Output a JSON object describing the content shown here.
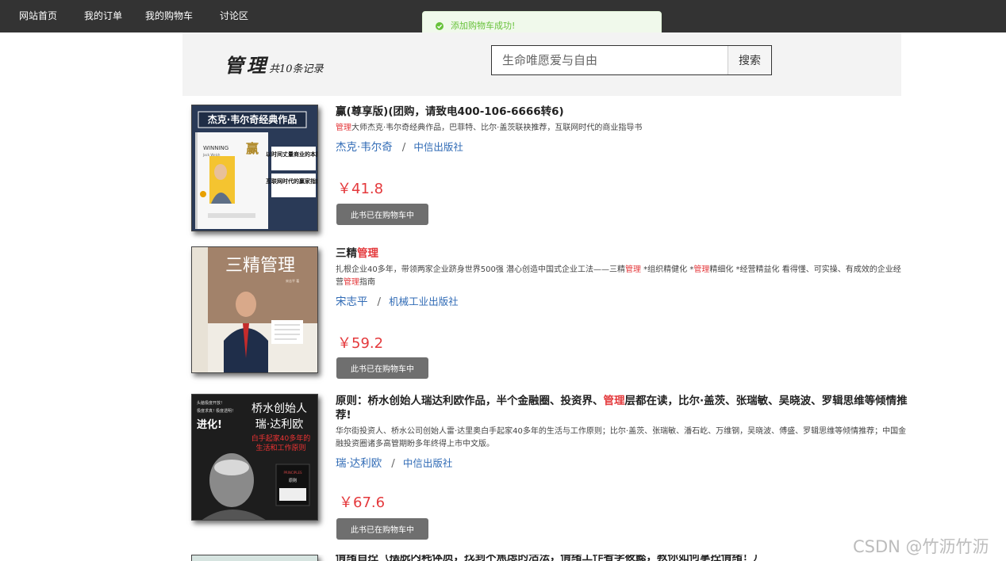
{
  "nav": {
    "home": "网站首页",
    "orders": "我的订单",
    "cart": "我的购物车",
    "forum": "讨论区"
  },
  "toast": {
    "message": "添加购物车成功!",
    "status_color": "#67c23a"
  },
  "header": {
    "title": "管理",
    "subtitle": "共10条记录",
    "search_placeholder": "生命唯愿爱与自由",
    "search_button": "搜索"
  },
  "books": [
    {
      "title": "赢(尊享版)(团购，请致电400-106-6666转6)",
      "desc_parts": [
        {
          "text": "管理",
          "hl": true
        },
        {
          "text": "大师杰克·韦尔奇经典作品，巴菲特、比尔·盖茨联袂推荐，互联网时代的商业指导书",
          "hl": false
        }
      ],
      "author": "杰克·韦尔奇",
      "publisher": "中信出版社",
      "price": "￥41.8",
      "button": "此书已在购物车中",
      "cover": {
        "banner": "杰克·韦尔奇经典作品",
        "title_en": "WINNING",
        "author_en": "Jack Welch",
        "title_cn": "赢",
        "side1": "以时间丈量商业的本质",
        "side2": "互联网时代的赢家指南"
      }
    },
    {
      "title_parts": [
        {
          "text": "三精",
          "hl": false
        },
        {
          "text": "管理",
          "hl": true
        }
      ],
      "desc_parts": [
        {
          "text": "扎根企业40多年，带领两家企业跻身世界500强 潜心创造中国式企业工法——三精",
          "hl": false
        },
        {
          "text": "管理",
          "hl": true
        },
        {
          "text": " *组织精健化 *",
          "hl": false
        },
        {
          "text": "管理",
          "hl": true
        },
        {
          "text": "精细化 *经营精益化 看得懂、可实操、有成效的企业经营",
          "hl": false
        },
        {
          "text": "管理",
          "hl": true
        },
        {
          "text": "指南",
          "hl": false
        }
      ],
      "author": "宋志平",
      "publisher": "机械工业出版社",
      "price": "￥59.2",
      "button": "此书已在购物车中",
      "cover": {
        "title_cn": "三精管理",
        "author_cn": "宋志平 著"
      }
    },
    {
      "title_parts": [
        {
          "text": "原则：桥水创始人瑞达利欧作品，半个金融圈、投资界、",
          "hl": false
        },
        {
          "text": "管理",
          "hl": true
        },
        {
          "text": "层都在读，比尔·盖茨、张瑞敏、吴晓波、罗辑思维等倾情推荐!",
          "hl": false
        }
      ],
      "desc": "华尔街投资人、桥水公司创始人雷·达里奥白手起家40多年的生活与工作原则；比尔·盖茨、张瑞敏、潘石屹、万维钢，吴晓波、傅盛、罗辑思维等倾情推荐；中国金融投资圈诸多高管期盼多年终得上市中文版。",
      "author": "瑞·达利欧",
      "publisher": "中信出版社",
      "price": "￥67.6",
      "button": "此书已在购物车中",
      "cover": {
        "top": "头脑极度开放！",
        "mid1": "极度求真！",
        "mid2": "极度透明！",
        "evolve": "进化!",
        "big1": "桥水创始人",
        "big2": "瑞·达利欧",
        "red1": "白手起家40多年的",
        "red2": "生活和工作原则",
        "book_en": "PRINCIPLES",
        "book_cn": "原则"
      }
    },
    {
      "title": "情绪自控（摆脱内耗体质，找到不焦虑的活法，情绪工作者李筱懿，教你如何掌控情绪！）"
    }
  ],
  "watermark": "CSDN @竹沥竹沥"
}
